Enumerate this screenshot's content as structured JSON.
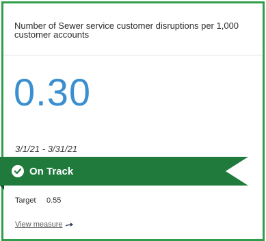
{
  "card": {
    "title": "Number of Sewer service customer disruptions per 1,000 customer accounts",
    "value": "0.30",
    "date_range": "3/1/21 - 3/31/21",
    "status": {
      "label": "On Track",
      "icon": "check-circle-icon",
      "color": "#1f7a3c"
    },
    "target": {
      "label": "Target",
      "value": "0.55"
    },
    "view_link": {
      "label": "View measure",
      "icon": "arrow-right-icon"
    }
  },
  "colors": {
    "border": "#2e9e49",
    "value": "#3a8fd0",
    "banner": "#1f7a3c"
  }
}
